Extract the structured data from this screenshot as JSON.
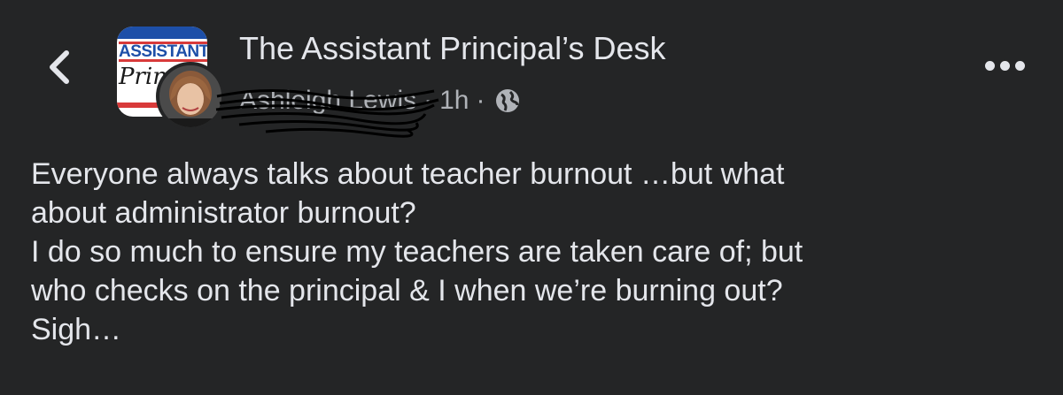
{
  "header": {
    "page_title": "The Assistant Principal’s Desk",
    "author_name": "Ashleigh Lewis",
    "separator": "·",
    "timestamp": "1h",
    "privacy_icon": "globe-icon",
    "back_icon": "chevron-left-icon",
    "more_icon": "more-horizontal-icon"
  },
  "group_avatar": {
    "line1": "ASSISTANT",
    "line2": "Prin"
  },
  "post": {
    "lines": [
      "Everyone always talks about teacher burnout …but what",
      "about administrator burnout?",
      "I do so much to ensure my teachers are taken care of; but",
      "who checks on the principal & I when we’re burning out?",
      "Sigh…"
    ]
  },
  "colors": {
    "background": "#242526",
    "primary_text": "#e4e6eb",
    "secondary_text": "#b0b3b8"
  }
}
